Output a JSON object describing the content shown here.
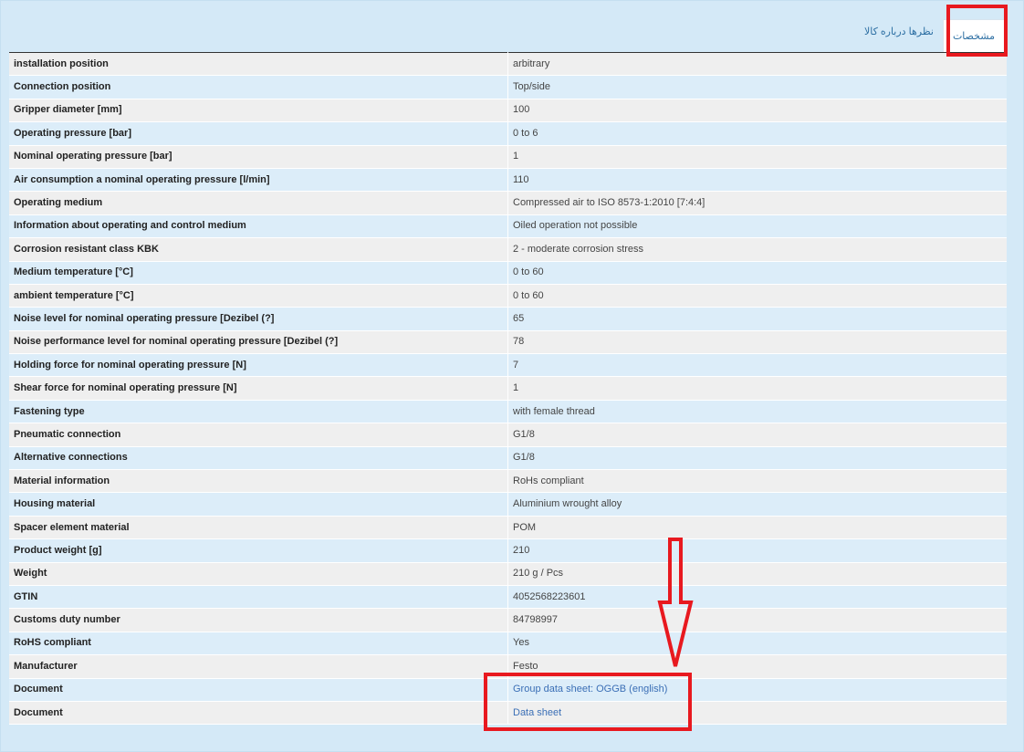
{
  "tabs": {
    "specs_label": "مشخصات",
    "reviews_label": "نظرها درباره کالا"
  },
  "colors": {
    "annotation": "#e8191f",
    "link": "#3b6fb6",
    "background": "#d4e9f7"
  },
  "specs": [
    {
      "label": "installation position",
      "value": "arbitrary"
    },
    {
      "label": "Connection position",
      "value": "Top/side"
    },
    {
      "label": "Gripper diameter [mm]",
      "value": "100"
    },
    {
      "label": "Operating pressure [bar]",
      "value": "0 to 6"
    },
    {
      "label": "Nominal operating pressure [bar]",
      "value": "1"
    },
    {
      "label": "Air consumption a nominal operating pressure [l/min]",
      "value": "110"
    },
    {
      "label": "Operating medium",
      "value": "Compressed air to ISO 8573-1:2010 [7:4:4]"
    },
    {
      "label": "Information about operating and control medium",
      "value": "Oiled operation not possible"
    },
    {
      "label": "Corrosion resistant class KBK",
      "value": "2 - moderate corrosion stress"
    },
    {
      "label": "Medium temperature [°C]",
      "value": "0 to 60"
    },
    {
      "label": "ambient temperature [°C]",
      "value": "0 to 60"
    },
    {
      "label": "Noise level for nominal operating pressure [Dezibel (?]",
      "value": "65"
    },
    {
      "label": "Noise performance level for nominal operating pressure [Dezibel (?]",
      "value": "78"
    },
    {
      "label": "Holding force for nominal operating pressure [N]",
      "value": "7"
    },
    {
      "label": "Shear force for nominal operating pressure [N]",
      "value": "1"
    },
    {
      "label": "Fastening type",
      "value": "with female thread"
    },
    {
      "label": "Pneumatic connection",
      "value": "G1/8"
    },
    {
      "label": "Alternative connections",
      "value": "G1/8"
    },
    {
      "label": "Material information",
      "value": "RoHs compliant"
    },
    {
      "label": "Housing material",
      "value": "Aluminium wrought alloy"
    },
    {
      "label": "Spacer element material",
      "value": "POM"
    },
    {
      "label": "Product weight [g]",
      "value": "210"
    },
    {
      "label": "Weight",
      "value": "210 g / Pcs"
    },
    {
      "label": "GTIN",
      "value": "4052568223601"
    },
    {
      "label": "Customs duty number",
      "value": "84798997"
    },
    {
      "label": "RoHS compliant",
      "value": "Yes"
    },
    {
      "label": "Manufacturer",
      "value": "Festo"
    },
    {
      "label": "Document",
      "value": "Group data sheet: OGGB (english)",
      "link": true
    },
    {
      "label": "Document",
      "value": "Data sheet",
      "link": true
    }
  ]
}
